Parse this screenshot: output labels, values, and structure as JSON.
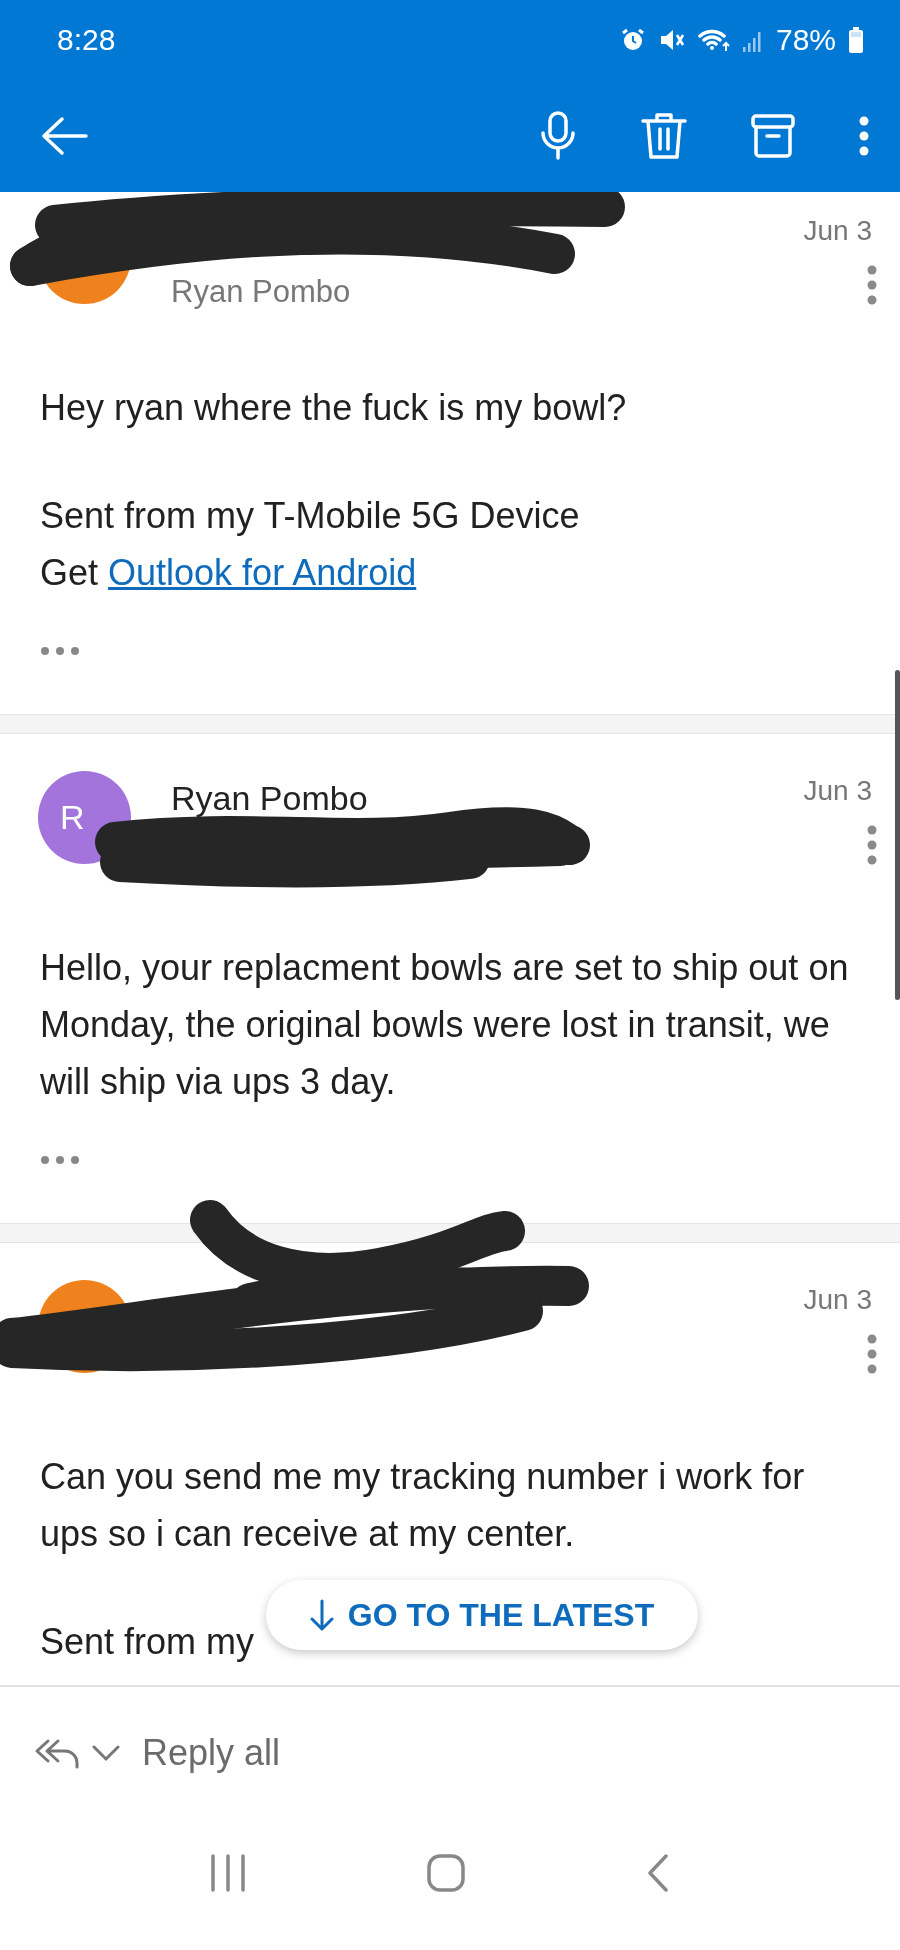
{
  "status_bar": {
    "time": "8:28",
    "battery": "78%"
  },
  "messages": [
    {
      "avatar": {
        "color": "#f0821e"
      },
      "recipient": "Ryan Pombo",
      "date": "Jun 3",
      "redacted": true,
      "has_quoted": true,
      "paragraphs": [
        [
          {
            "text": "Hey ryan where the fuck is my bowl?"
          }
        ],
        [
          {
            "text": "Sent from my T-Mobile 5G Device"
          },
          {
            "text": "Get",
            "link": "Outlook for Android"
          }
        ]
      ]
    },
    {
      "avatar": {
        "initials": "R",
        "color": "#a274dc"
      },
      "sender": "Ryan Pombo",
      "date": "Jun 3",
      "redacted": true,
      "has_quoted": true,
      "paragraphs": [
        [
          {
            "text": "Hello, your replacment bowls are set to ship out on Monday, the original bowls were lost in transit, we will ship via ups 3 day."
          }
        ]
      ]
    },
    {
      "avatar": {
        "color": "#f0821e"
      },
      "date": "Jun 3",
      "redacted": true,
      "has_quoted": false,
      "paragraphs": [
        [
          {
            "text": "Can you send me my tracking number i work for ups so i can receive at my center."
          }
        ],
        [
          {
            "text": "Sent from my"
          }
        ]
      ]
    }
  ],
  "jump_button": {
    "label": "GO TO THE LATEST"
  },
  "reply_bar": {
    "label": "Reply all"
  }
}
